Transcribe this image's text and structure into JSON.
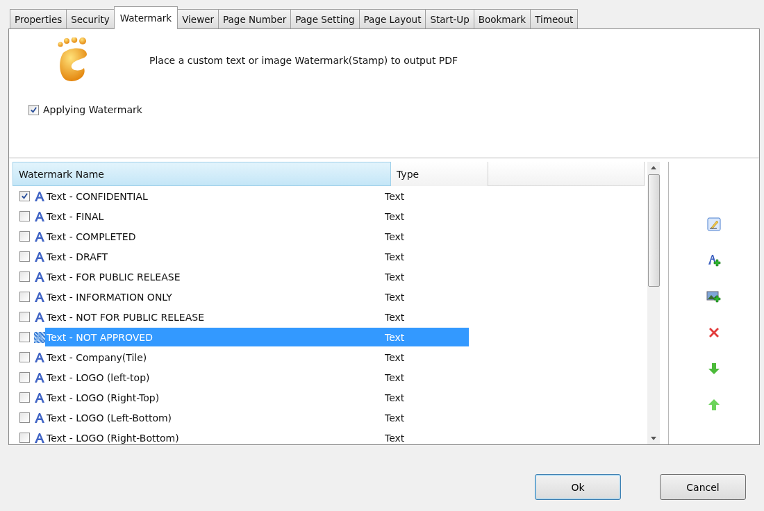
{
  "tabs": [
    {
      "label": "Properties",
      "selected": false
    },
    {
      "label": "Security",
      "selected": false
    },
    {
      "label": "Watermark",
      "selected": true
    },
    {
      "label": "Viewer",
      "selected": false
    },
    {
      "label": "Page Number",
      "selected": false
    },
    {
      "label": "Page Setting",
      "selected": false
    },
    {
      "label": "Page Layout",
      "selected": false
    },
    {
      "label": "Start-Up",
      "selected": false
    },
    {
      "label": "Bookmark",
      "selected": false
    },
    {
      "label": "Timeout",
      "selected": false
    }
  ],
  "description": "Place a custom text or image Watermark(Stamp) to output PDF",
  "applying_watermark": {
    "label": "Applying Watermark",
    "checked": true
  },
  "table": {
    "columns": [
      "Watermark Name",
      "Type"
    ],
    "rows": [
      {
        "name": "Text - CONFIDENTIAL",
        "type": "Text",
        "checked": true,
        "selected": false
      },
      {
        "name": "Text - FINAL",
        "type": "Text",
        "checked": false,
        "selected": false
      },
      {
        "name": "Text - COMPLETED",
        "type": "Text",
        "checked": false,
        "selected": false
      },
      {
        "name": "Text - DRAFT",
        "type": "Text",
        "checked": false,
        "selected": false
      },
      {
        "name": "Text - FOR PUBLIC RELEASE",
        "type": "Text",
        "checked": false,
        "selected": false
      },
      {
        "name": "Text - INFORMATION ONLY",
        "type": "Text",
        "checked": false,
        "selected": false
      },
      {
        "name": "Text - NOT FOR PUBLIC RELEASE",
        "type": "Text",
        "checked": false,
        "selected": false
      },
      {
        "name": "Text - NOT APPROVED",
        "type": "Text",
        "checked": false,
        "selected": true
      },
      {
        "name": "Text - Company(Tile)",
        "type": "Text",
        "checked": false,
        "selected": false
      },
      {
        "name": "Text - LOGO (left-top)",
        "type": "Text",
        "checked": false,
        "selected": false
      },
      {
        "name": "Text - LOGO (Right-Top)",
        "type": "Text",
        "checked": false,
        "selected": false
      },
      {
        "name": "Text - LOGO (Left-Bottom)",
        "type": "Text",
        "checked": false,
        "selected": false
      },
      {
        "name": "Text - LOGO (Right-Bottom)",
        "type": "Text",
        "checked": false,
        "selected": false
      }
    ]
  },
  "buttons": [
    "Ok",
    "Cancel"
  ]
}
